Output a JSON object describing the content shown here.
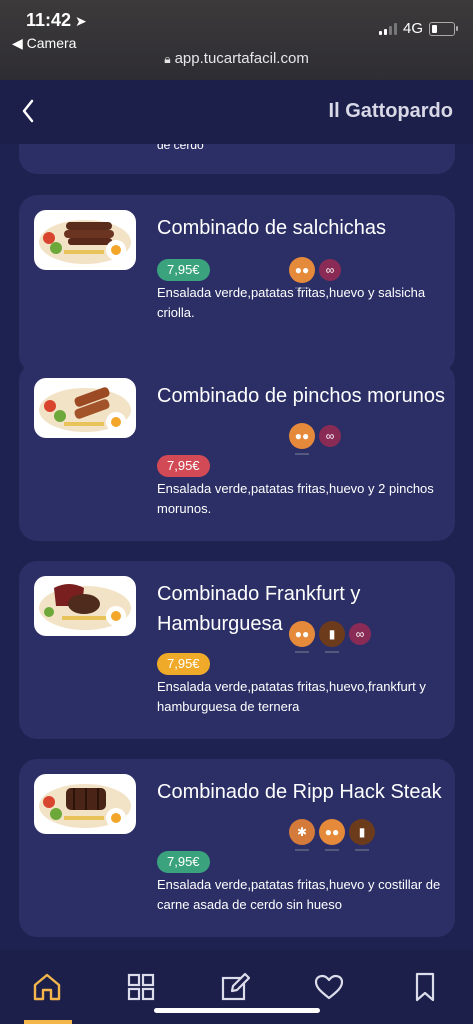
{
  "status": {
    "time": "11:42",
    "back_app": "Camera",
    "network": "4G",
    "url": "app.tucartafacil.com"
  },
  "header": {
    "title": "Il Gattopardo"
  },
  "partial_item": {
    "desc_tail": "de cerdo"
  },
  "items": [
    {
      "title": "Combinado de salchichas",
      "price": "7,95€",
      "price_color": "#3aa37e",
      "description": "Ensalada verde,patatas fritas,huevo y salsicha criolla.",
      "allergens": [
        "egg-icon",
        "lupin-icon"
      ]
    },
    {
      "title": "Combinado de pinchos morunos",
      "price": "7,95€",
      "price_color": "#d14a56",
      "description": "Ensalada verde,patatas fritas,huevo y 2 pinchos morunos.",
      "allergens": [
        "egg-icon",
        "lupin-icon"
      ]
    },
    {
      "title": "Combinado Frankfurt y Hamburguesa",
      "price": "7,95€",
      "price_color": "#f0aa2a",
      "description": "Ensalada verde,patatas fritas,huevo,frankfurt y hamburguesa de ternera",
      "allergens": [
        "egg-icon",
        "milk-icon",
        "lupin-icon"
      ]
    },
    {
      "title": "Combinado de Ripp Hack Steak",
      "price": "7,95€",
      "price_color": "#3aa37e",
      "description": "Ensalada verde,patatas fritas,huevo y costillar de carne asada de cerdo sin hueso",
      "allergens": [
        "gluten-icon",
        "egg-icon",
        "milk-icon"
      ]
    }
  ],
  "nav": {
    "items": [
      "home-icon",
      "grid-icon",
      "edit-icon",
      "heart-icon",
      "bookmark-icon"
    ],
    "active_color": "#f4b54a"
  }
}
